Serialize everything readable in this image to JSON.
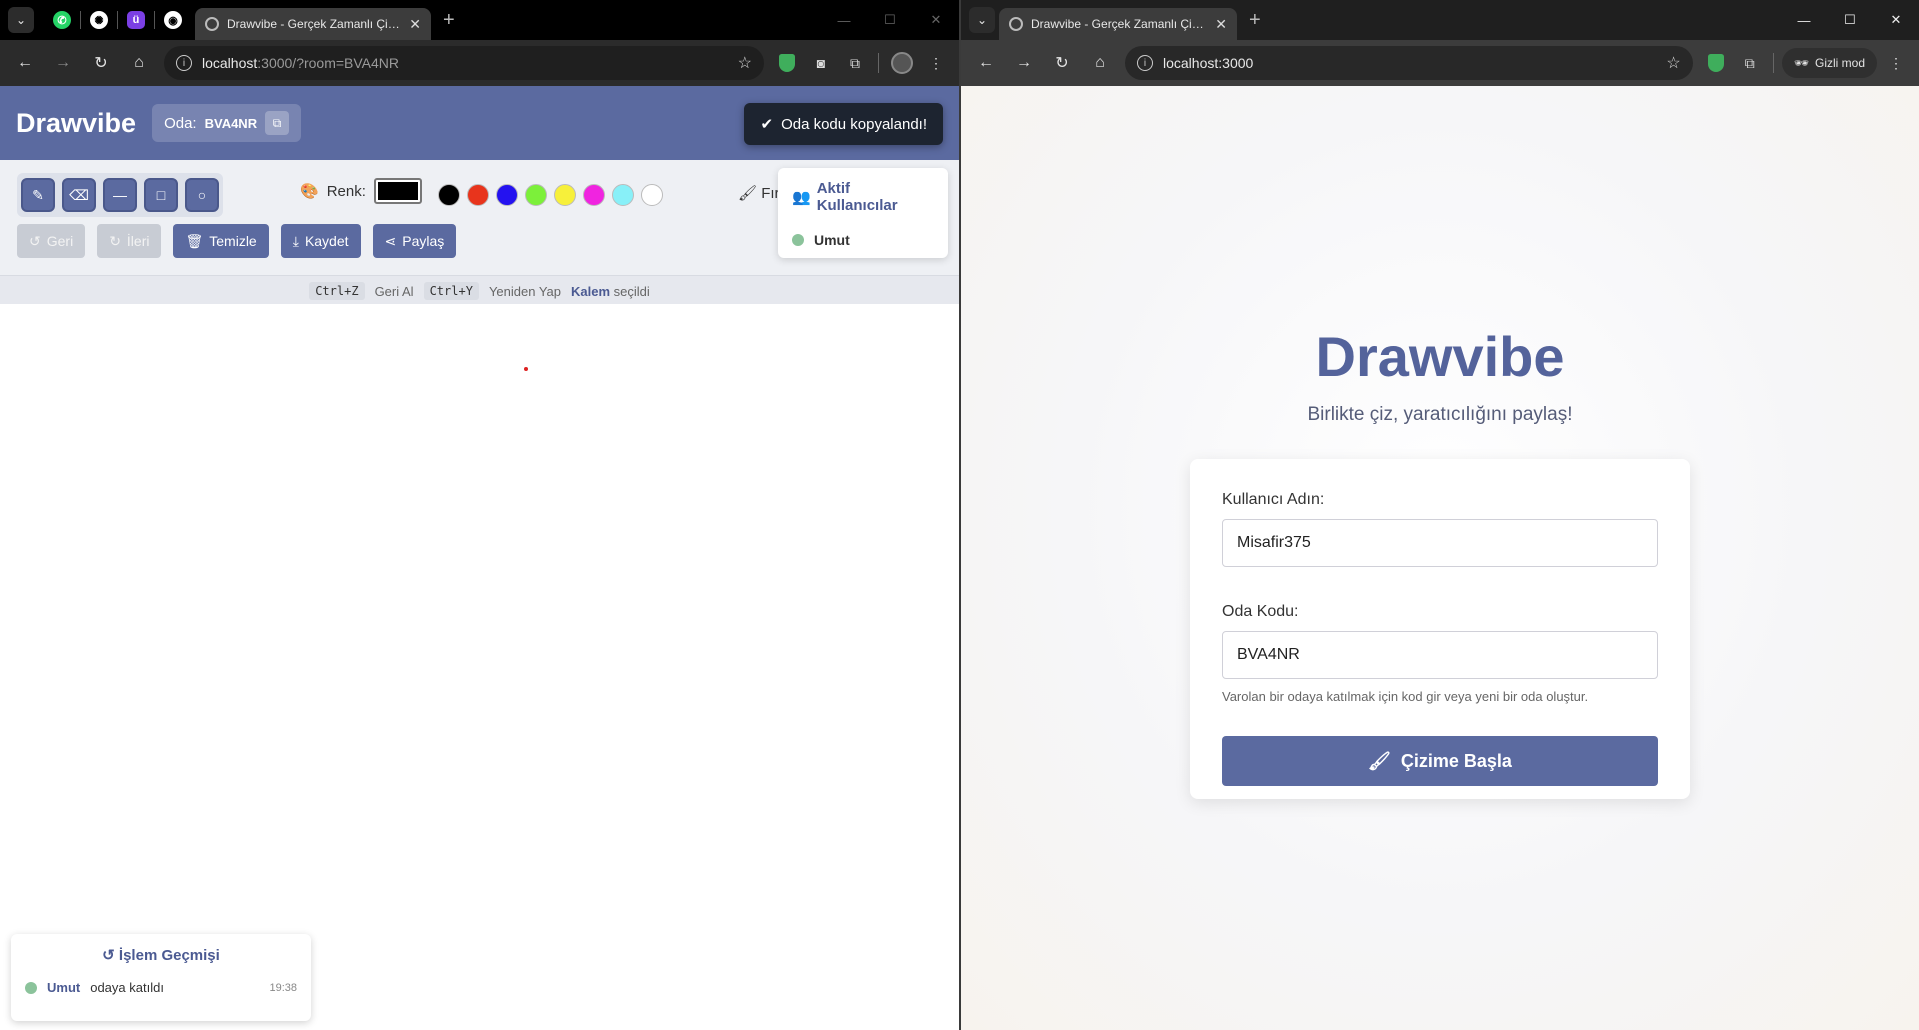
{
  "left_window": {
    "tab_title": "Drawvibe - Gerçek Zamanlı Çizim",
    "url_host": "localhost",
    "url_path": ":3000/?room=BVA4NR"
  },
  "right_window": {
    "tab_title": "Drawvibe - Gerçek Zamanlı Çizim",
    "url_host": "localhost",
    "url_path": ":3000",
    "incognito_label": "Gizli mod"
  },
  "app": {
    "brand": "Drawvibe",
    "room_label": "Oda:",
    "room_code": "BVA4NR",
    "toast": "Oda kodu kopyalandı!",
    "color_label": "Renk:",
    "current_color": "#000000",
    "swatches": [
      "#000000",
      "#e8341c",
      "#2412f0",
      "#7cf03a",
      "#f7f03a",
      "#f024e0",
      "#88f0f8",
      "#ffffff"
    ],
    "brush_label": "Fırça",
    "actions": {
      "undo": "Geri",
      "redo": "İleri",
      "clear": "Temizle",
      "save": "Kaydet",
      "share": "Paylaş"
    },
    "users_title": "Aktif Kullanıcılar",
    "users": [
      {
        "name": "Umut"
      }
    ],
    "shortcuts": {
      "undo_key": "Ctrl+Z",
      "undo_text": "Geri Al",
      "redo_key": "Ctrl+Y",
      "redo_text": "Yeniden Yap",
      "tool_name": "Kalem",
      "tool_suffix": "seçildi"
    },
    "history": {
      "title": "İşlem Geçmişi",
      "items": [
        {
          "user": "Umut",
          "action": "odaya katıldı",
          "time": "19:38"
        }
      ]
    }
  },
  "landing": {
    "title": "Drawvibe",
    "subtitle": "Birlikte çiz, yaratıcılığını paylaş!",
    "username_label": "Kullanıcı Adın:",
    "username_value": "Misafir375",
    "room_label": "Oda Kodu:",
    "room_value": "BVA4NR",
    "hint": "Varolan bir odaya katılmak için kod gir veya yeni bir oda oluştur.",
    "start_button": "Çizime Başla"
  },
  "colors": {
    "accent": "#5b6aa0",
    "toast_bg": "#1d2430",
    "online": "#8bc39b"
  }
}
